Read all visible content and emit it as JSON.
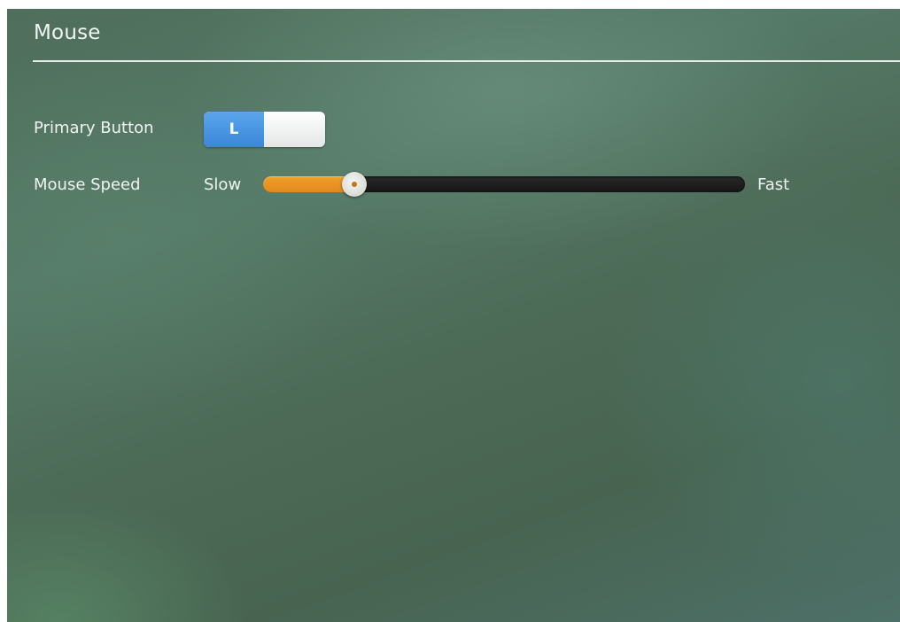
{
  "section": {
    "title": "Mouse"
  },
  "primary_button": {
    "label": "Primary Button",
    "selected_value": "L",
    "accent_color": "#3b86d8"
  },
  "mouse_speed": {
    "label": "Mouse Speed",
    "min_label": "Slow",
    "max_label": "Fast",
    "value_fraction": 0.19,
    "fill_color": "#e08a1c"
  }
}
